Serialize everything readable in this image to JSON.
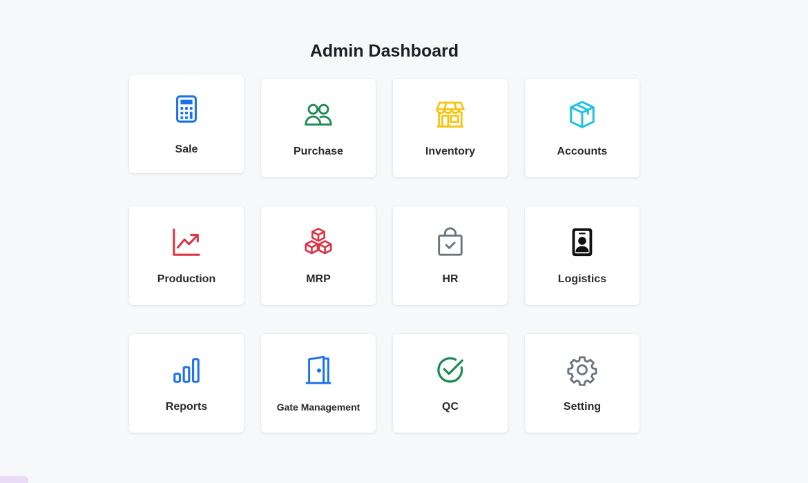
{
  "header": {
    "title": "Admin Dashboard"
  },
  "colors": {
    "blue": "#1a73e8",
    "green": "#1e8a55",
    "yellow": "#f5c518",
    "cyan": "#22c3dc",
    "red": "#dc3545",
    "gray": "#6c757d",
    "black": "#111111"
  },
  "modules": [
    {
      "label": "Sale",
      "icon": "calculator-icon"
    },
    {
      "label": "Purchase",
      "icon": "people-icon"
    },
    {
      "label": "Inventory",
      "icon": "shop-icon"
    },
    {
      "label": "Accounts",
      "icon": "box-icon"
    },
    {
      "label": "Production",
      "icon": "graph-up-arrow-icon"
    },
    {
      "label": "MRP",
      "icon": "boxes-icon"
    },
    {
      "label": "HR",
      "icon": "bag-check-icon"
    },
    {
      "label": "Logistics",
      "icon": "person-badge-icon"
    },
    {
      "label": "Reports",
      "icon": "bar-chart-icon"
    },
    {
      "label": "Gate Management",
      "icon": "door-open-icon"
    },
    {
      "label": "QC",
      "icon": "check-circle-icon"
    },
    {
      "label": "Setting",
      "icon": "gear-icon"
    }
  ]
}
